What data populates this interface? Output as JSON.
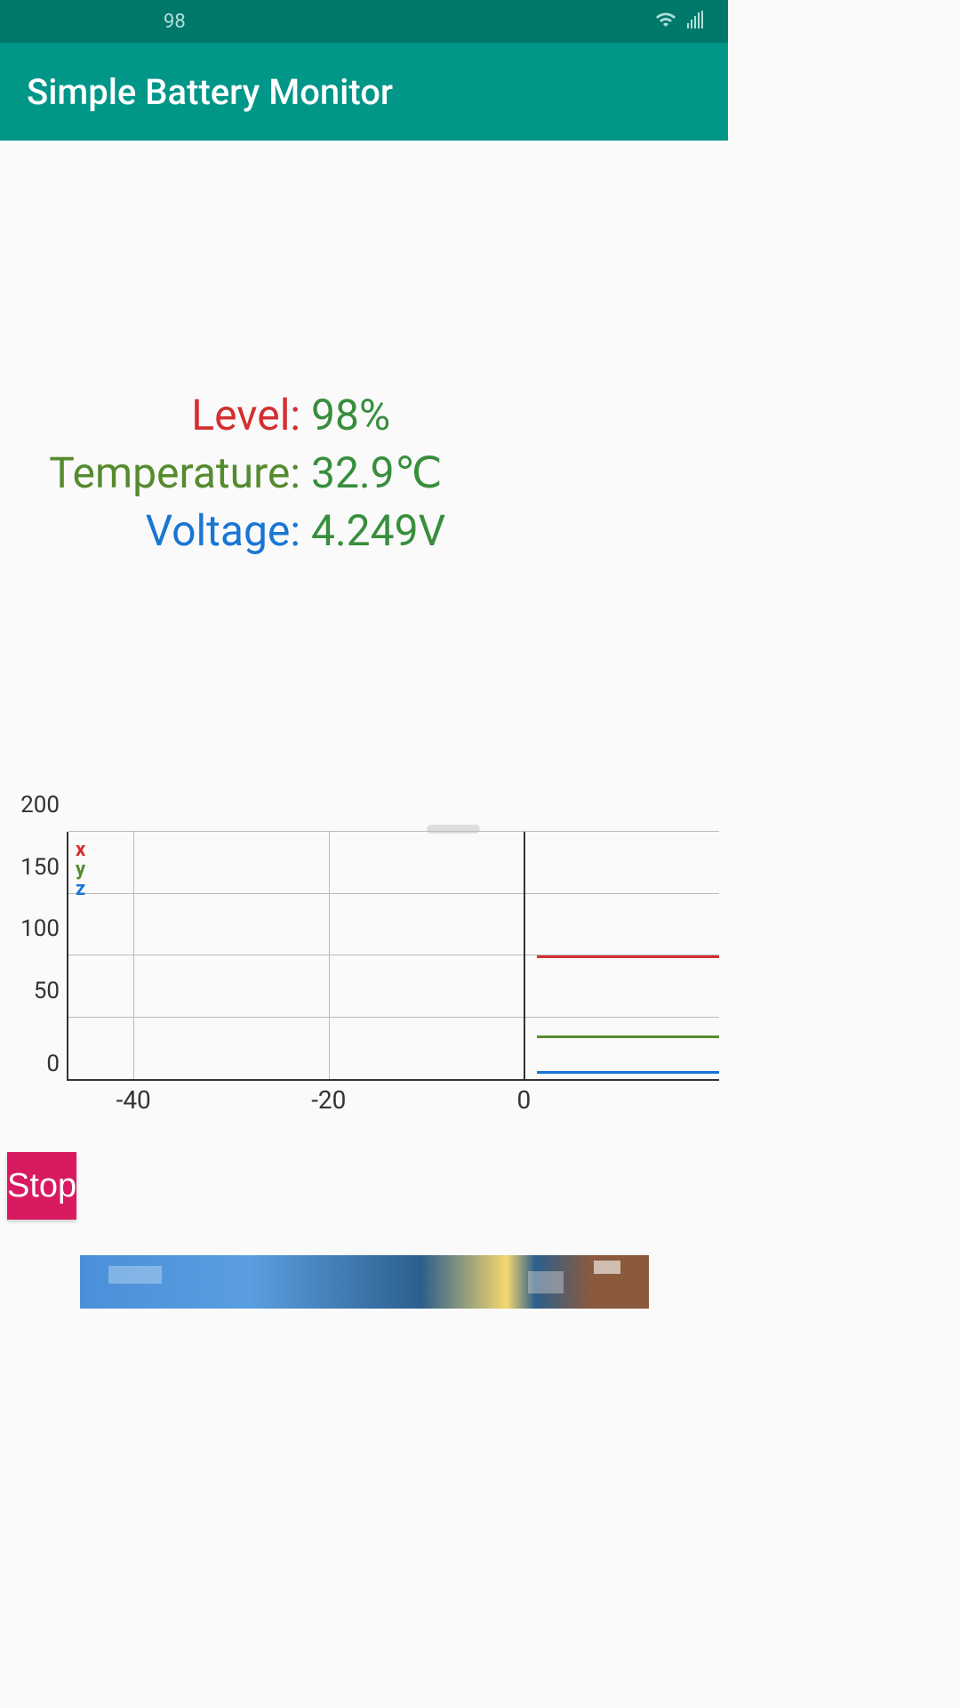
{
  "status_bar": {
    "battery_indicator": "98"
  },
  "app": {
    "title": "Simple Battery Monitor"
  },
  "stats": {
    "level": {
      "label": "Level:",
      "value": "98%"
    },
    "temperature": {
      "label": "Temperature:",
      "value": "32.9℃"
    },
    "voltage": {
      "label": "Voltage:",
      "value": "4.249V"
    }
  },
  "chart_data": {
    "type": "line",
    "xlabel": "",
    "ylabel": "",
    "xlim": [
      -47,
      10
    ],
    "ylim": [
      0,
      200
    ],
    "x_ticks": [
      -40,
      -20,
      0
    ],
    "y_ticks": [
      0,
      50,
      100,
      150,
      200
    ],
    "legend": [
      "x",
      "y",
      "z"
    ],
    "series": [
      {
        "name": "x",
        "color": "#d32f2f",
        "x": [
          0,
          10
        ],
        "values": [
          98,
          98
        ]
      },
      {
        "name": "y",
        "color": "#558b2f",
        "x": [
          0,
          10
        ],
        "values": [
          33,
          33
        ]
      },
      {
        "name": "z",
        "color": "#1976d2",
        "x": [
          0,
          10
        ],
        "values": [
          4,
          4
        ]
      }
    ]
  },
  "button": {
    "stop_label": "Stop"
  }
}
